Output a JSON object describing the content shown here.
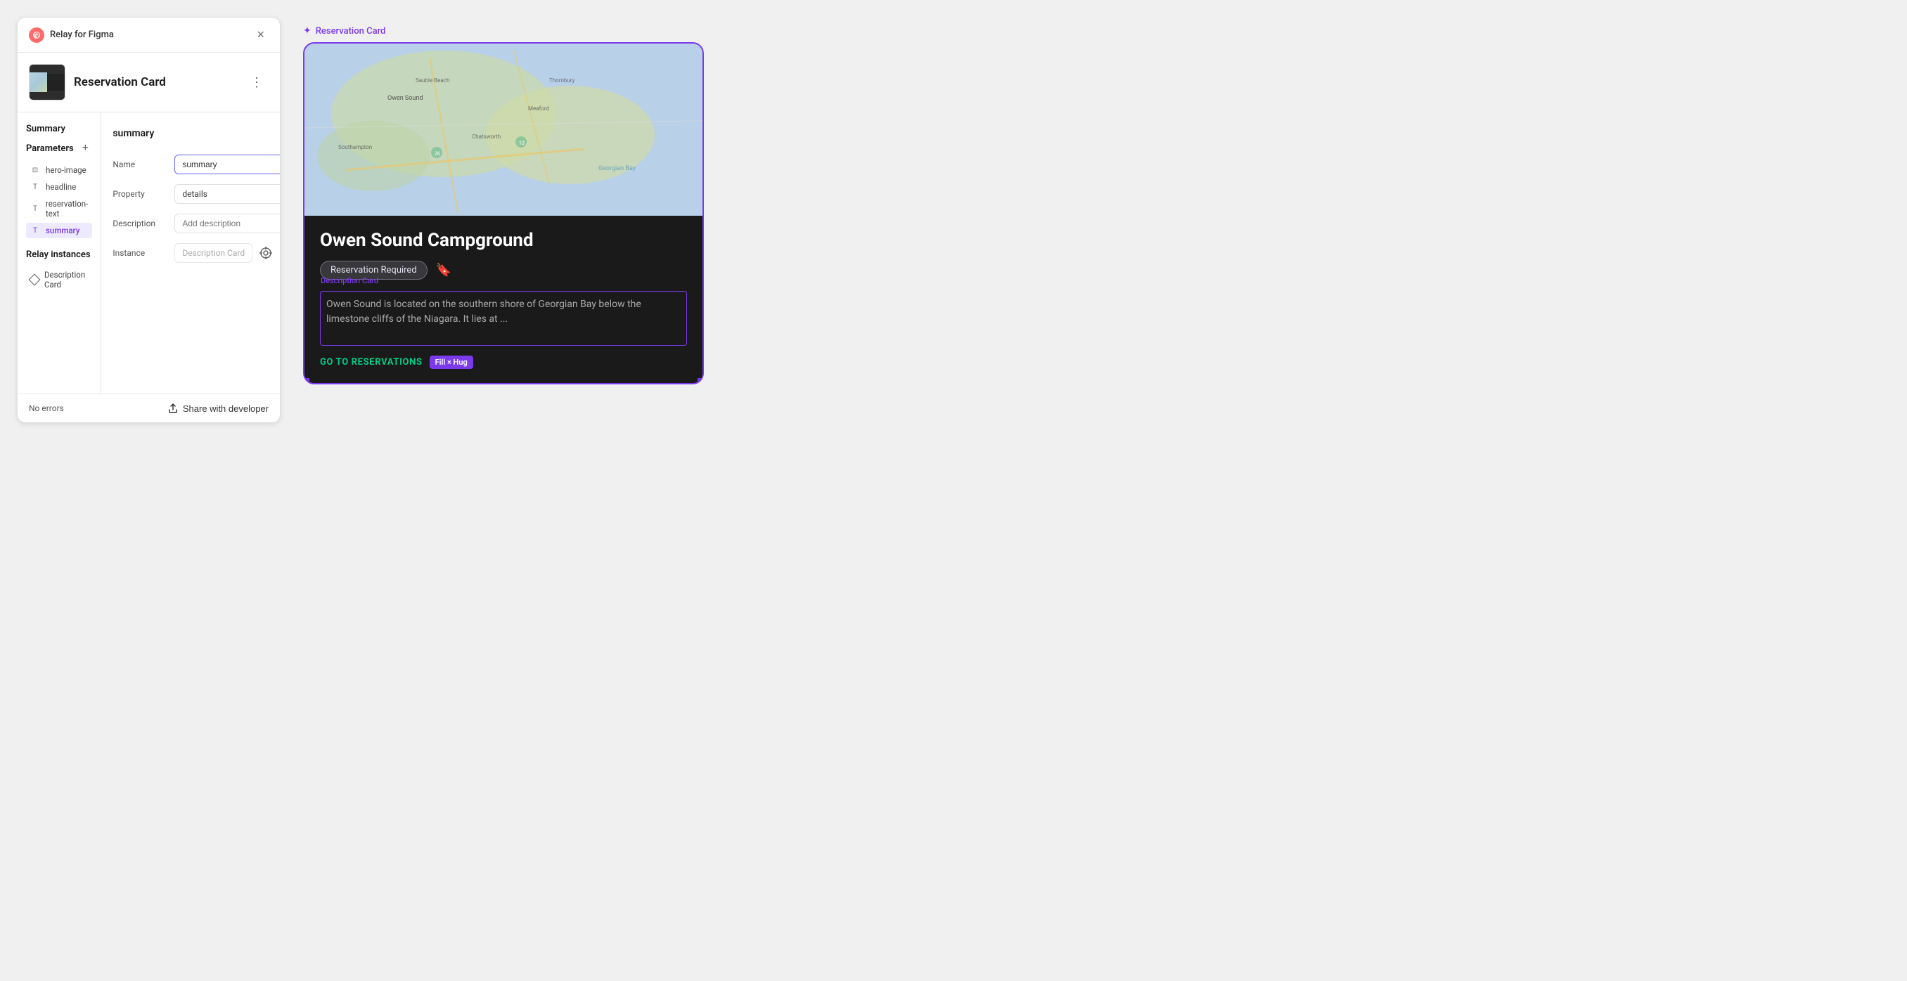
{
  "app": {
    "title": "Relay for Figma",
    "close_label": "×"
  },
  "component": {
    "name": "Reservation Card",
    "thumbnail_alt": "Reservation Card thumbnail"
  },
  "sidebar": {
    "summary_title": "Summary",
    "parameters_title": "Parameters",
    "add_param_label": "+",
    "params": [
      {
        "id": "hero-image",
        "type": "image",
        "label": "hero-image",
        "active": false
      },
      {
        "id": "headline",
        "type": "text",
        "label": "headline",
        "active": false
      },
      {
        "id": "reservation-text",
        "type": "text",
        "label": "reservation-text",
        "active": false
      },
      {
        "id": "summary",
        "type": "text",
        "label": "summary",
        "active": true
      }
    ],
    "relay_instances_title": "Relay instances",
    "relay_items": [
      {
        "id": "description-card",
        "label": "Description Card"
      }
    ]
  },
  "detail": {
    "title": "summary",
    "name_label": "Name",
    "name_value": "summary",
    "property_label": "Property",
    "property_value": "details",
    "description_label": "Description",
    "description_placeholder": "Add description",
    "instance_label": "Instance",
    "instance_value": "Description Card"
  },
  "footer": {
    "no_errors": "No errors",
    "share_label": "Share with developer"
  },
  "preview": {
    "relay_label": "Reservation Card",
    "card": {
      "title": "Owen Sound Campground",
      "badge": "Reservation Required",
      "description": "Owen Sound is located on the southern shore of Georgian Bay below the limestone cliffs of the Niagara. It lies at ...",
      "cta": "GO TO RESERVATIONS",
      "fill_hug": "Fill × Hug",
      "description_card_label": "Description Card"
    }
  },
  "icons": {
    "relay": "❤",
    "close": "×",
    "more": "⋮",
    "trash": "🗑",
    "chevron_down": "▾",
    "target": "⊕",
    "share": "⇪",
    "relay_purple": "✦",
    "bookmark": "🔖",
    "image_type": "⊡",
    "text_type": "T",
    "diamond": "◇"
  }
}
